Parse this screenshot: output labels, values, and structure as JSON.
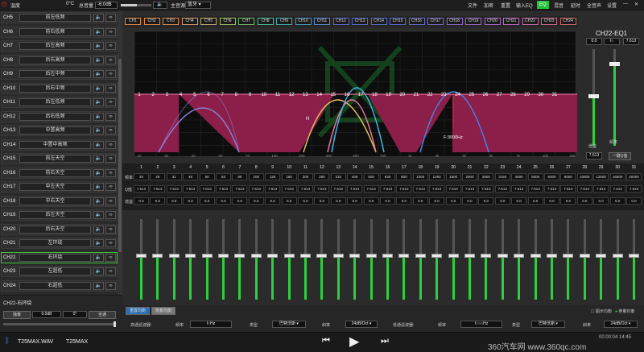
{
  "topbar": {
    "temp_label": "温度",
    "temp_value": "0°C",
    "volume_label": "总音量",
    "volume_value": "-6.0dB",
    "source_label": "主音源",
    "source_value": "蓝牙",
    "menu": [
      "文件",
      "加密",
      "重置",
      "输入EQ",
      "EQ",
      "混音",
      "延时",
      "全音声",
      "设置"
    ],
    "active_menu": "EQ"
  },
  "channels": [
    {
      "id": "CH5",
      "name": "前左低频"
    },
    {
      "id": "CH6",
      "name": "前右低频"
    },
    {
      "id": "CH7",
      "name": "后左高频"
    },
    {
      "id": "CH8",
      "name": "后右高频"
    },
    {
      "id": "CH9",
      "name": "后左中频"
    },
    {
      "id": "CH10",
      "name": "后右中频"
    },
    {
      "id": "CH11",
      "name": "后左低频"
    },
    {
      "id": "CH12",
      "name": "后右低频"
    },
    {
      "id": "CH13",
      "name": "中置高频"
    },
    {
      "id": "CH14",
      "name": "中置中高频"
    },
    {
      "id": "CH15",
      "name": "前左天空"
    },
    {
      "id": "CH16",
      "name": "前右天空"
    },
    {
      "id": "CH17",
      "name": "中左天空"
    },
    {
      "id": "CH18",
      "name": "中右天空"
    },
    {
      "id": "CH19",
      "name": "后左天空"
    },
    {
      "id": "CH20",
      "name": "后右天空"
    },
    {
      "id": "CH21",
      "name": "左环绕"
    },
    {
      "id": "CH22",
      "name": "右环绕"
    },
    {
      "id": "CH23",
      "name": "左超低"
    },
    {
      "id": "CH24",
      "name": "右超低"
    }
  ],
  "selected_channel": "CH22",
  "left_bottom": {
    "title": "CH22-右环绕",
    "btn1": "独奏",
    "gain": "0.0dB",
    "phase": "0°",
    "btn2": "全通"
  },
  "channel_tabs": [
    "CH1",
    "CH2",
    "CH3",
    "CH4",
    "CH5",
    "CH6",
    "CH7",
    "CH8",
    "CH9",
    "CH10",
    "CH11",
    "CH12",
    "CH13",
    "CH14",
    "CH15",
    "CH16",
    "CH17",
    "CH18",
    "CH19",
    "CH20",
    "CH21",
    "CH22",
    "CH23",
    "CH24"
  ],
  "graph": {
    "band_markers": [
      "1",
      "2",
      "3",
      "4",
      "5",
      "6",
      "7",
      "8",
      "9",
      "10",
      "11",
      "12",
      "13",
      "14",
      "15",
      "16",
      "17",
      "18",
      "19",
      "20",
      "21",
      "22",
      "23",
      "24",
      "25",
      "26",
      "27",
      "28",
      "29",
      "30",
      "31"
    ],
    "h_marker": "H",
    "freq_readout": "F:3000Hz",
    "freq_ticks": [
      "20",
      "30",
      "40",
      "50",
      "70",
      "100",
      "200",
      "300",
      "500",
      "700",
      "1k",
      "2k",
      "3k",
      "5k",
      "7k",
      "10k",
      "20k"
    ]
  },
  "right_panel": {
    "title": "CH22-EQ1",
    "box_left": "0.0",
    "box_mid": "I○",
    "box_right": "7.613",
    "gain_label": "增益",
    "freq_label": "频率",
    "gain_value": "7.613",
    "eq_button": "一键Q值"
  },
  "band_table": {
    "row_labels": [
      "频率",
      "Q值",
      "增益"
    ],
    "bands": [
      "1",
      "2",
      "3",
      "4",
      "5",
      "6",
      "7",
      "8",
      "9",
      "10",
      "11",
      "12",
      "13",
      "14",
      "15",
      "16",
      "17",
      "18",
      "19",
      "20",
      "21",
      "22",
      "23",
      "24",
      "25",
      "26",
      "27",
      "28",
      "29",
      "30",
      "31"
    ],
    "freq": [
      "20",
      "25",
      "31",
      "40",
      "50",
      "63",
      "80",
      "100",
      "125",
      "160",
      "200",
      "250",
      "315",
      "400",
      "500",
      "630",
      "800",
      "1000",
      "1250",
      "1600",
      "2000",
      "2500",
      "3150",
      "4000",
      "5000",
      "6300",
      "8000",
      "10000",
      "12500",
      "16000",
      "20000"
    ],
    "q": [
      "7.613",
      "7.613",
      "7.613",
      "7.613",
      "7.613",
      "7.613",
      "7.613",
      "7.613",
      "7.613",
      "7.613",
      "7.613",
      "7.613",
      "7.613",
      "7.613",
      "7.613",
      "7.613",
      "7.613",
      "7.613",
      "7.613",
      "7.613",
      "7.613",
      "7.613",
      "7.613",
      "7.613",
      "7.613",
      "7.613",
      "7.613",
      "7.613",
      "7.613",
      "7.613",
      "7.613"
    ],
    "gain": [
      "0.0",
      "0.0",
      "0.0",
      "0.0",
      "0.0",
      "0.0",
      "0.0",
      "0.0",
      "0.0",
      "0.0",
      "0.0",
      "0.0",
      "0.0",
      "0.0",
      "0.0",
      "0.0",
      "0.0",
      "0.0",
      "0.0",
      "0.0",
      "0.0",
      "0.0",
      "0.0",
      "0.0",
      "0.0",
      "0.0",
      "0.0",
      "0.0",
      "0.0",
      "0.0",
      "0.0"
    ]
  },
  "fader_level": 0.55,
  "eq_bar": {
    "btn_reset": "重置均衡",
    "btn_restore": "恢复均衡",
    "check1": "图示均衡",
    "check2": "参量均衡",
    "hp_label": "高通滤波器:",
    "hp_freq_label": "频率",
    "hp_freq": "I○Hz",
    "hp_type_label": "类型",
    "hp_type": "巴特沃斯",
    "hp_slope_label": "斜率",
    "hp_slope": "24dB/Oct",
    "lp_label": "低通滤波器:",
    "lp_freq_label": "频率",
    "lp_freq": "I○○○Hz",
    "lp_type_label": "类型",
    "lp_type": "巴特沃斯",
    "lp_slope_label": "斜率",
    "lp_slope": "24dB/Oct"
  },
  "player": {
    "track1": "T25MAX.WAV",
    "track2": "T25MAX",
    "time": "00:00:04 14:45",
    "watermark": "360汽车网 www.360qc.com"
  },
  "colors": {
    "accent": "#2ecf3e",
    "curve_fill": "#8b1f4a",
    "background": "#2b2b2b"
  }
}
